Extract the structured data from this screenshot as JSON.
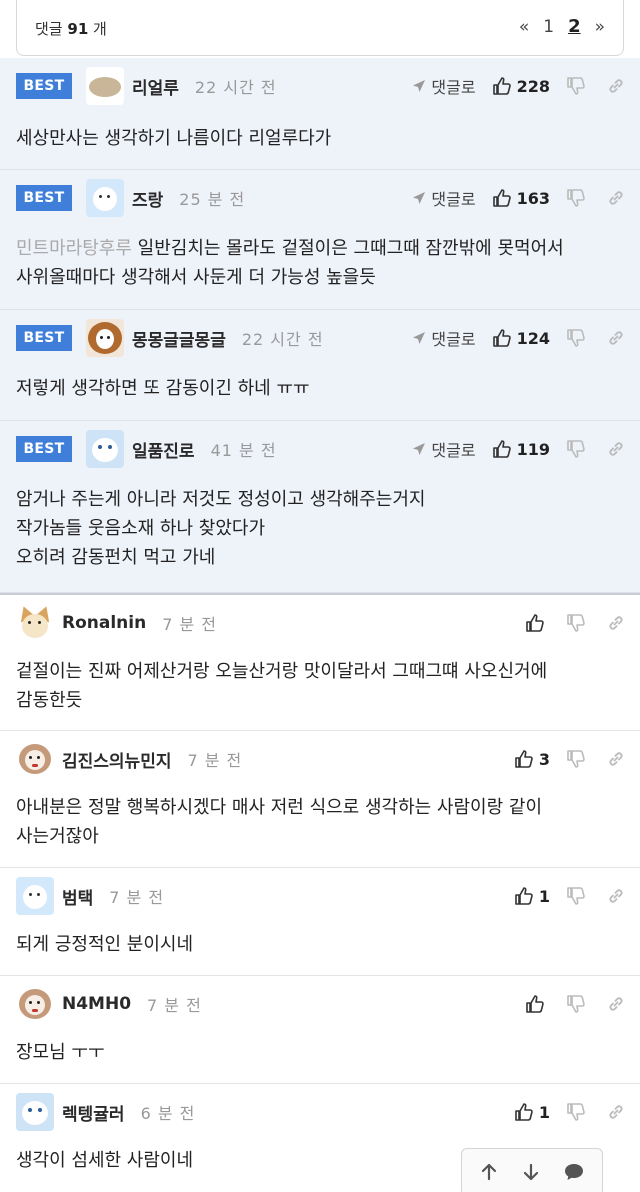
{
  "header": {
    "count_prefix": "댓글",
    "count": "91",
    "count_suffix": "개",
    "pager": {
      "first": "«",
      "page1": "1",
      "page2": "2",
      "next": "»"
    }
  },
  "labels": {
    "best": "BEST",
    "reply": "댓글로"
  },
  "comments": [
    {
      "nick": "리얼루",
      "time": "22 시간 전",
      "likes": "228",
      "prefix": "",
      "text": [
        "세상만사는 생각하기 나름이다 리얼루다가"
      ]
    },
    {
      "nick": "즈랑",
      "time": "25 분 전",
      "likes": "163",
      "prefix": "민트마라탕후루",
      "text": [
        " 일반김치는 몰라도 겉절이은 그때그때 잠깐밖에 못먹어서",
        "사위올때마다 생각해서 사둔게 더 가능성 높을듯"
      ]
    },
    {
      "nick": "몽몽글글몽글",
      "time": "22 시간 전",
      "likes": "124",
      "prefix": "",
      "text": [
        "저렇게 생각하면 또 감동이긴 하네 ㅠㅠ"
      ]
    },
    {
      "nick": "일품진로",
      "time": "41 분 전",
      "likes": "119",
      "prefix": "",
      "text": [
        "암거나 주는게 아니라 저것도 정성이고 생각해주는거지",
        "작가놈들 웃음소재 하나 찾았다가",
        "오히려 감동펀치 먹고 가네"
      ]
    },
    {
      "nick": "Ronalnin",
      "time": "7 분 전",
      "likes": "",
      "prefix": "",
      "text": [
        "겉절이는 진짜 어제산거랑 오늘산거랑 맛이달라서 그때그떄 사오신거에",
        "감동한듯"
      ]
    },
    {
      "nick": "김진스의뉴민지",
      "time": "7 분 전",
      "likes": "3",
      "prefix": "",
      "text": [
        "아내분은 정말 행복하시겠다 매사 저런 식으로 생각하는 사람이랑 같이",
        "사는거잖아"
      ]
    },
    {
      "nick": "범택",
      "time": "7 분 전",
      "likes": "1",
      "prefix": "",
      "text": [
        "되게 긍정적인 분이시네"
      ]
    },
    {
      "nick": "N4MH0",
      "time": "7 분 전",
      "likes": "",
      "prefix": "",
      "text": [
        "장모님 ㅜㅜ"
      ]
    },
    {
      "nick": "렉텡귤러",
      "time": "6 분 전",
      "likes": "1",
      "prefix": "",
      "text": [
        "생각이 섬세한 사람이네"
      ]
    }
  ],
  "icons": {
    "up": "arrow-up-icon",
    "down": "arrow-down-icon",
    "chat": "chat-bubble-icon",
    "like": "thumbs-up-icon",
    "dislike": "thumbs-down-icon",
    "link": "link-icon",
    "reply": "reply-arrow-icon"
  },
  "colors": {
    "best_badge": "#3f7fd9",
    "best_bg": "#eef2f9",
    "muted": "#999999"
  }
}
